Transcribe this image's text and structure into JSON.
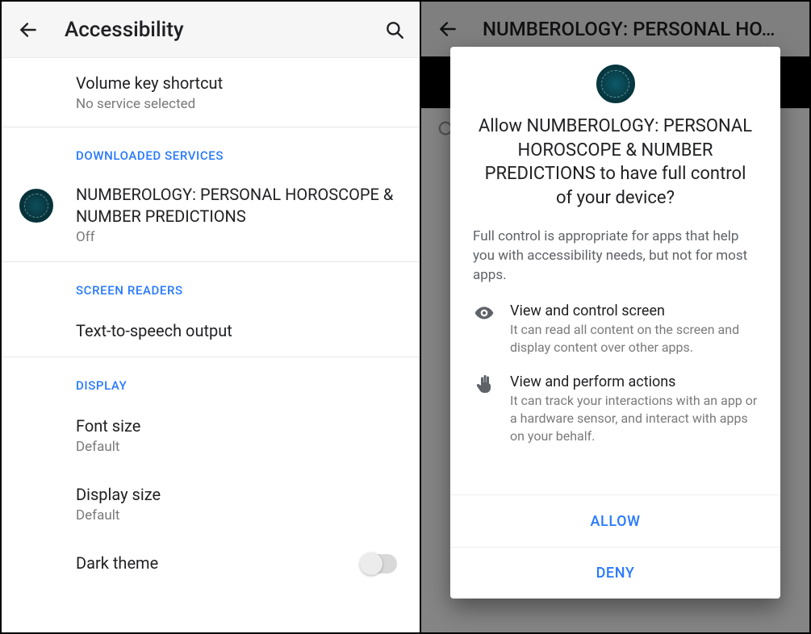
{
  "left": {
    "appbar_title": "Accessibility",
    "items": {
      "volume_key": {
        "title": "Volume key shortcut",
        "sub": "No service selected"
      },
      "downloaded_header": "DOWNLOADED SERVICES",
      "app_service": {
        "title": "NUMBEROLOGY: PERSONAL HOROSCOPE & NUMBER PREDICTIONS",
        "sub": "Off"
      },
      "screen_readers_header": "SCREEN READERS",
      "tts": {
        "title": "Text-to-speech output"
      },
      "display_header": "DISPLAY",
      "font_size": {
        "title": "Font size",
        "sub": "Default"
      },
      "display_size": {
        "title": "Display size",
        "sub": "Default"
      },
      "dark_theme": {
        "title": "Dark theme"
      }
    }
  },
  "right": {
    "appbar_title": "NUMBEROLOGY: PERSONAL HO…",
    "dialog": {
      "title": "Allow NUMBEROLOGY: PERSONAL HOROSCOPE & NUMBER PREDICTIONS to have full control of your device?",
      "description": "Full control is appropriate for apps that help you with accessibility needs, but not for most apps.",
      "perm1": {
        "title": "View and control screen",
        "sub": "It can read all content on the screen and display content over other apps."
      },
      "perm2": {
        "title": "View and perform actions",
        "sub": "It can track your interactions with an app or a hardware sensor, and interact with apps on your behalf."
      },
      "allow": "ALLOW",
      "deny": "DENY"
    }
  }
}
